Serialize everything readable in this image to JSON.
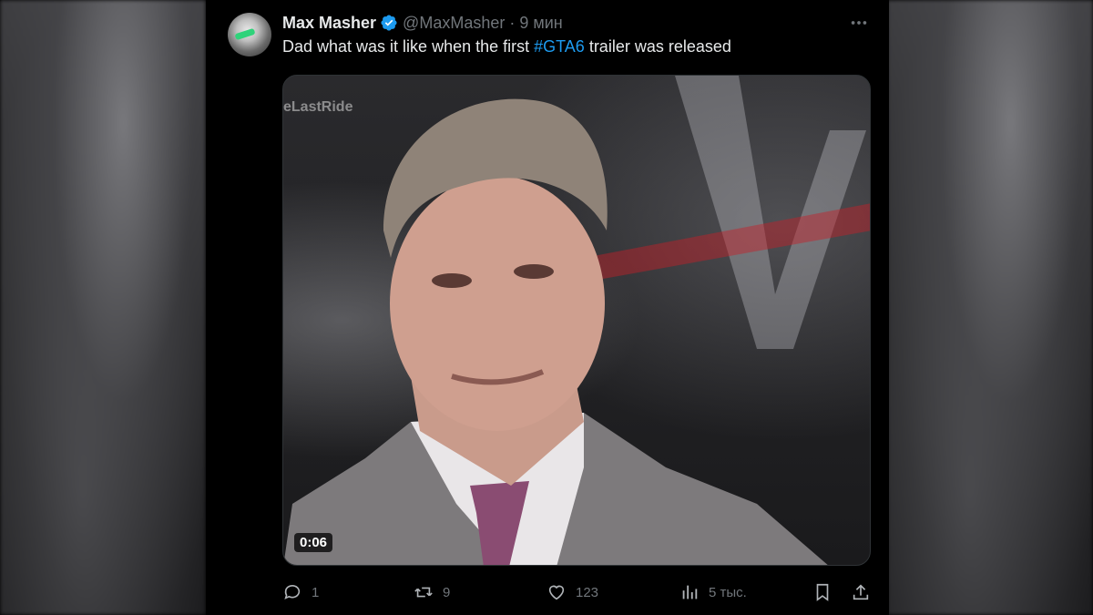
{
  "tweet": {
    "author_name": "Max Masher",
    "handle": "@MaxMasher",
    "separator": "·",
    "time": "9 мин",
    "text_before": "Dad what was it like when the first ",
    "hashtag": "#GTA6",
    "text_after": " trailer was released",
    "verified": true
  },
  "media": {
    "watermark": "eLastRide",
    "duration": "0:06",
    "icon": "video"
  },
  "actions": {
    "replies": "1",
    "reposts": "9",
    "likes": "123",
    "views": "5 тыс."
  },
  "colors": {
    "background": "#000000",
    "text": "#e7e9ea",
    "secondary": "#71767b",
    "link": "#1d9bf0",
    "verified": "#1d9bf0"
  }
}
